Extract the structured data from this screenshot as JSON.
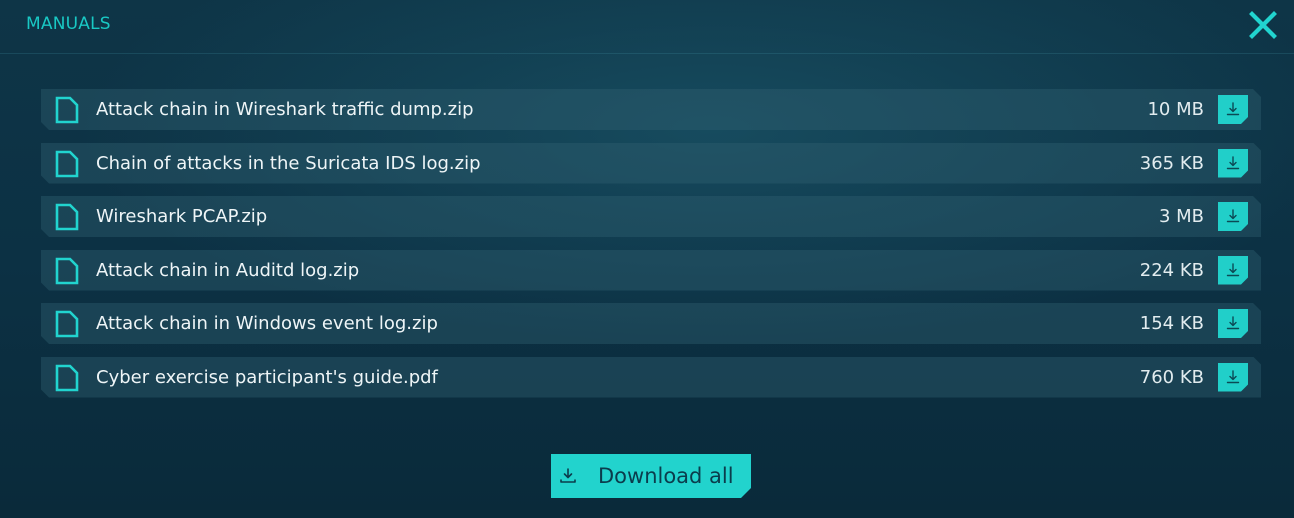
{
  "dialog": {
    "title": "MANUALS",
    "close_icon": "close-x-icon",
    "accent_color": "#21cfc9"
  },
  "files": [
    {
      "name": "Attack chain in Wireshark traffic dump.zip",
      "size": "10 MB",
      "icon": "document-icon"
    },
    {
      "name": "Chain of attacks in the Suricata IDS log.zip",
      "size": "365 KB",
      "icon": "document-icon"
    },
    {
      "name": "Wireshark PCAP.zip",
      "size": "3 MB",
      "icon": "document-icon"
    },
    {
      "name": "Attack chain in Auditd log.zip",
      "size": "224 KB",
      "icon": "document-icon"
    },
    {
      "name": "Attack chain in Windows event log.zip",
      "size": "154 KB",
      "icon": "document-icon"
    },
    {
      "name": "Cyber exercise participant's guide.pdf",
      "size": "760 KB",
      "icon": "document-icon"
    }
  ],
  "footer": {
    "download_all_label": "Download all",
    "download_icon": "download-icon"
  }
}
